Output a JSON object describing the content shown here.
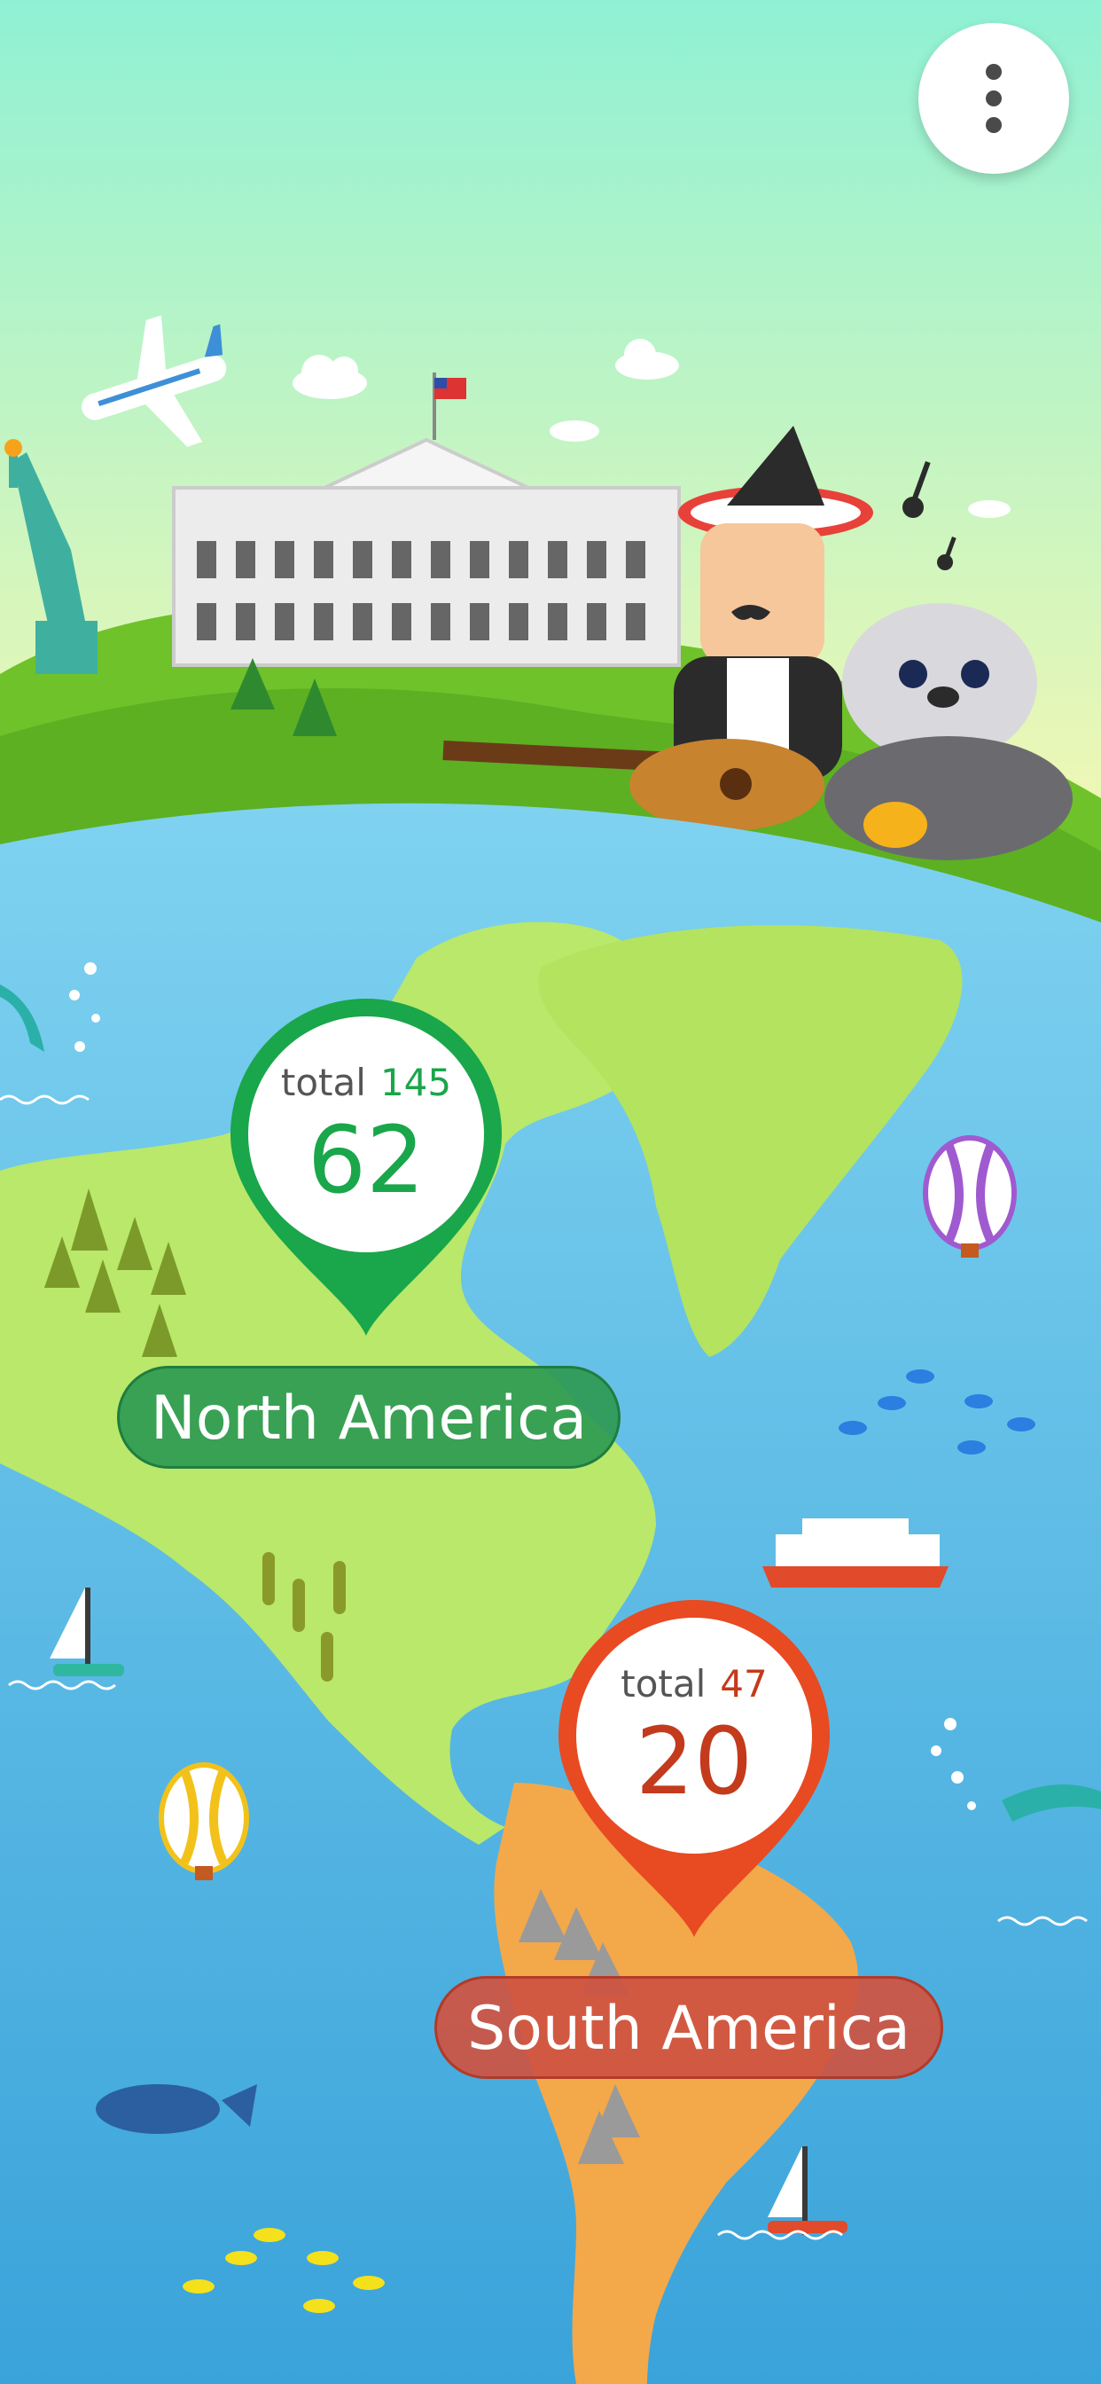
{
  "menu": {
    "icon": "more-vertical-icon"
  },
  "regions": [
    {
      "name": "North America",
      "total_label": "total",
      "total": "145",
      "count": "62",
      "color": "#1aa64a",
      "label_bg": "#2e9a52"
    },
    {
      "name": "South America",
      "total_label": "total",
      "total": "47",
      "count": "20",
      "color": "#e84a22",
      "label_bg": "#cf5240"
    }
  ],
  "colors": {
    "sky_top": "#8ff1d4",
    "sky_bottom": "#f2f8b4",
    "ocean": "#63c0e8",
    "land_north": "#b9e86a",
    "land_south": "#f3a84a",
    "hill": "#6fc22a"
  }
}
